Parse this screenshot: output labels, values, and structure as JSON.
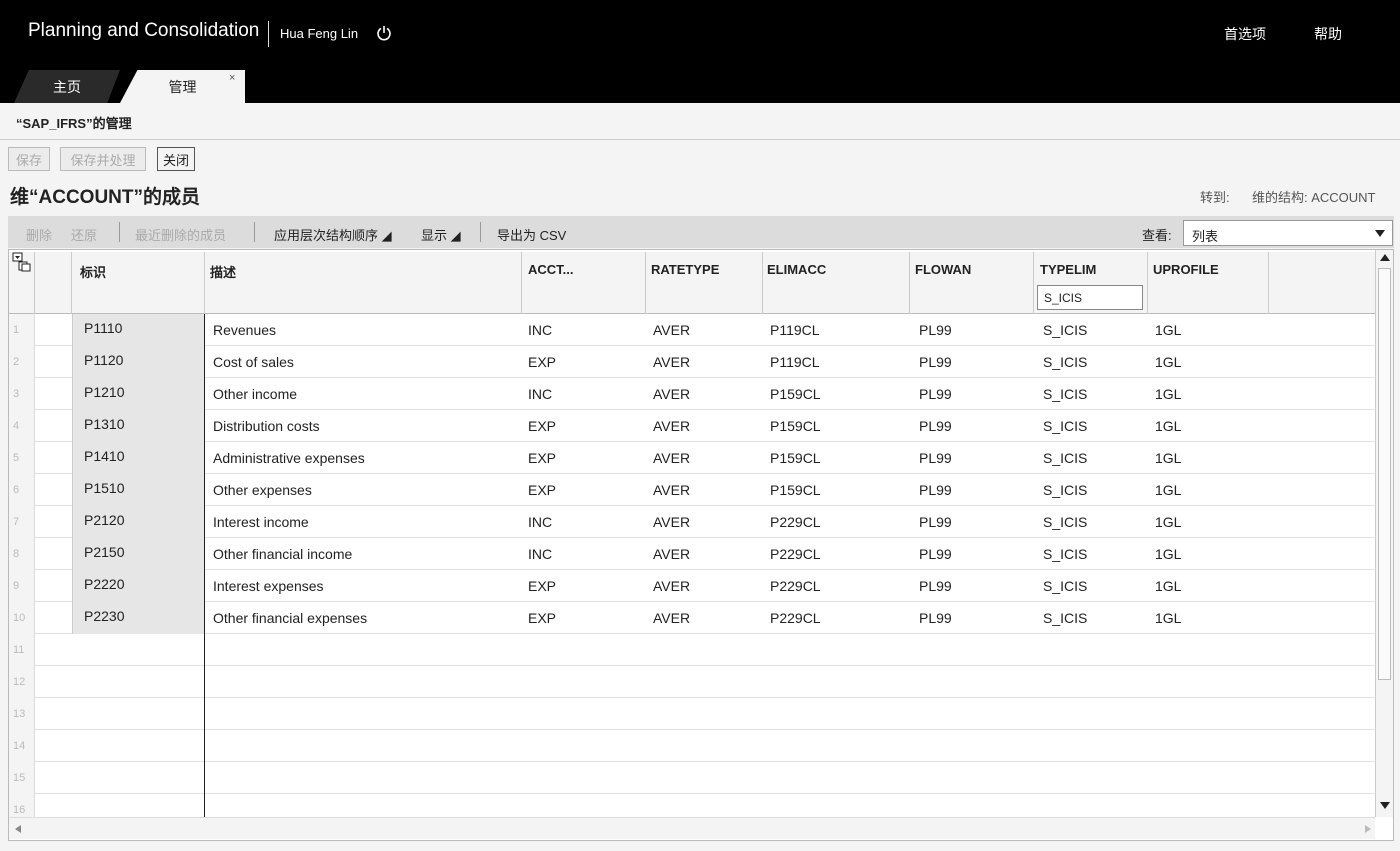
{
  "header": {
    "app_title": "Planning and Consolidation",
    "user": "Hua Feng Lin",
    "preferences": "首选项",
    "help": "帮助"
  },
  "tabs": [
    {
      "label": "主页"
    },
    {
      "label": "管理",
      "close": "×"
    }
  ],
  "breadcrumb": "“SAP_IFRS”的管理",
  "actions": {
    "save": "保存",
    "save_process": "保存并处理",
    "close": "关闭"
  },
  "page_title": "维“ACCOUNT”的成员",
  "goto": {
    "label": "转到:",
    "link": "维的结构: ACCOUNT"
  },
  "toolbar": {
    "delete": "删除",
    "restore": "还原",
    "recently_deleted": "最近删除的成员",
    "apply_hierarchy": "应用层次结构顺序 ◢",
    "display": "显示 ◢",
    "export_csv": "导出为 CSV",
    "view_label": "查看:",
    "view_value": "列表"
  },
  "grid": {
    "columns": [
      "标识",
      "描述",
      "ACCT...",
      "RATETYPE",
      "ELIMACC",
      "FLOWAN",
      "TYPELIM",
      "UPROFILE"
    ],
    "typelim_filter": "S_ICIS",
    "rows": [
      {
        "n": "1",
        "id": "P1110",
        "desc": "Revenues",
        "acct": "INC",
        "rate": "AVER",
        "elim": "P119CL",
        "flow": "PL99",
        "type": "S_ICIS",
        "up": "1GL"
      },
      {
        "n": "2",
        "id": "P1120",
        "desc": "Cost of sales",
        "acct": "EXP",
        "rate": "AVER",
        "elim": "P119CL",
        "flow": "PL99",
        "type": "S_ICIS",
        "up": "1GL"
      },
      {
        "n": "3",
        "id": "P1210",
        "desc": "Other income",
        "acct": "INC",
        "rate": "AVER",
        "elim": "P159CL",
        "flow": "PL99",
        "type": "S_ICIS",
        "up": "1GL"
      },
      {
        "n": "4",
        "id": "P1310",
        "desc": "Distribution costs",
        "acct": "EXP",
        "rate": "AVER",
        "elim": "P159CL",
        "flow": "PL99",
        "type": "S_ICIS",
        "up": "1GL"
      },
      {
        "n": "5",
        "id": "P1410",
        "desc": "Administrative expenses",
        "acct": "EXP",
        "rate": "AVER",
        "elim": "P159CL",
        "flow": "PL99",
        "type": "S_ICIS",
        "up": "1GL"
      },
      {
        "n": "6",
        "id": "P1510",
        "desc": "Other expenses",
        "acct": "EXP",
        "rate": "AVER",
        "elim": "P159CL",
        "flow": "PL99",
        "type": "S_ICIS",
        "up": "1GL"
      },
      {
        "n": "7",
        "id": "P2120",
        "desc": "Interest income",
        "acct": "INC",
        "rate": "AVER",
        "elim": "P229CL",
        "flow": "PL99",
        "type": "S_ICIS",
        "up": "1GL"
      },
      {
        "n": "8",
        "id": "P2150",
        "desc": "Other financial income",
        "acct": "INC",
        "rate": "AVER",
        "elim": "P229CL",
        "flow": "PL99",
        "type": "S_ICIS",
        "up": "1GL"
      },
      {
        "n": "9",
        "id": "P2220",
        "desc": "Interest expenses",
        "acct": "EXP",
        "rate": "AVER",
        "elim": "P229CL",
        "flow": "PL99",
        "type": "S_ICIS",
        "up": "1GL"
      },
      {
        "n": "10",
        "id": "P2230",
        "desc": "Other financial expenses",
        "acct": "EXP",
        "rate": "AVER",
        "elim": "P229CL",
        "flow": "PL99",
        "type": "S_ICIS",
        "up": "1GL"
      }
    ],
    "empty_rows": [
      "11",
      "12",
      "13",
      "14",
      "15",
      "16"
    ]
  }
}
